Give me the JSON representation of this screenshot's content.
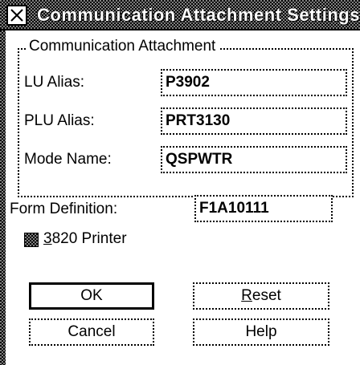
{
  "window": {
    "title": "Communication Attachment Settings"
  },
  "group": {
    "legend": "Communication Attachment",
    "lu_alias_label": "LU Alias:",
    "lu_alias_value": "P3902",
    "plu_alias_label": "PLU Alias:",
    "plu_alias_value": "PRT3130",
    "mode_name_label": "Mode Name:",
    "mode_name_value": "QSPWTR"
  },
  "form_definition": {
    "label": "Form Definition:",
    "value": "F1A10111"
  },
  "checkbox_3820": {
    "mnemonic": "3",
    "label_rest": "820 Printer",
    "checked": "indeterminate"
  },
  "buttons": {
    "ok": "OK",
    "reset_mnemonic": "R",
    "reset_rest": "eset",
    "cancel": "Cancel",
    "help": "Help"
  },
  "icons": {
    "system_menu": "system-menu-icon"
  }
}
